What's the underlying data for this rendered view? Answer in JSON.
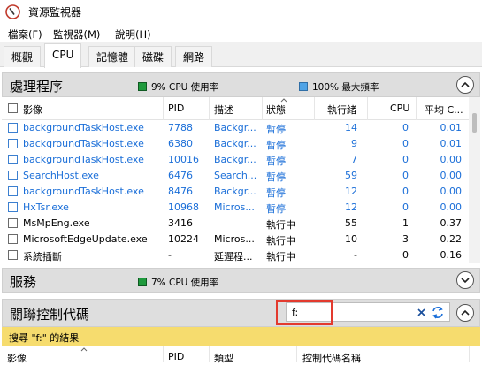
{
  "window": {
    "title": "資源監視器"
  },
  "menu": [
    "檔案(F)",
    "監視器(M)",
    "說明(H)"
  ],
  "tabs": [
    {
      "label": "概觀",
      "active": false
    },
    {
      "label": "CPU",
      "active": true
    },
    {
      "label": "記憶體",
      "active": false
    },
    {
      "label": "磁碟",
      "active": false
    },
    {
      "label": "網路",
      "active": false
    }
  ],
  "processes": {
    "title": "處理程序",
    "cpu_usage_text": "9% CPU 使用率",
    "max_freq_text": "100% 最大頻率",
    "columns": [
      "影像",
      "PID",
      "描述",
      "狀態",
      "執行緒",
      "CPU",
      "平均 C..."
    ],
    "rows": [
      {
        "image": "backgroundTaskHost.exe",
        "pid": "7788",
        "desc": "Backgr...",
        "status": "暫停",
        "threads": "14",
        "cpu": "0",
        "avg": "0.01",
        "suspended": true
      },
      {
        "image": "backgroundTaskHost.exe",
        "pid": "6380",
        "desc": "Backgr...",
        "status": "暫停",
        "threads": "9",
        "cpu": "0",
        "avg": "0.01",
        "suspended": true
      },
      {
        "image": "backgroundTaskHost.exe",
        "pid": "10016",
        "desc": "Backgr...",
        "status": "暫停",
        "threads": "7",
        "cpu": "0",
        "avg": "0.00",
        "suspended": true
      },
      {
        "image": "SearchHost.exe",
        "pid": "6476",
        "desc": "Search...",
        "status": "暫停",
        "threads": "59",
        "cpu": "0",
        "avg": "0.00",
        "suspended": true
      },
      {
        "image": "backgroundTaskHost.exe",
        "pid": "8476",
        "desc": "Backgr...",
        "status": "暫停",
        "threads": "12",
        "cpu": "0",
        "avg": "0.00",
        "suspended": true
      },
      {
        "image": "HxTsr.exe",
        "pid": "10968",
        "desc": "Micros...",
        "status": "暫停",
        "threads": "12",
        "cpu": "0",
        "avg": "0.00",
        "suspended": true
      },
      {
        "image": "MsMpEng.exe",
        "pid": "3416",
        "desc": "",
        "status": "執行中",
        "threads": "55",
        "cpu": "1",
        "avg": "0.37",
        "suspended": false
      },
      {
        "image": "MicrosoftEdgeUpdate.exe",
        "pid": "10224",
        "desc": "Micros...",
        "status": "執行中",
        "threads": "10",
        "cpu": "3",
        "avg": "0.22",
        "suspended": false
      },
      {
        "image": "系統插斷",
        "pid": "-",
        "desc": "延遲程...",
        "status": "執行中",
        "threads": "-",
        "cpu": "0",
        "avg": "0.16",
        "suspended": false
      }
    ]
  },
  "services": {
    "title": "服務",
    "cpu_usage_text": "7% CPU 使用率"
  },
  "handles": {
    "title": "關聯控制代碼",
    "search_value": "f:",
    "result_text": "搜尋 \"f:\" 的結果",
    "columns": [
      "影像",
      "PID",
      "類型",
      "控制代碼名稱"
    ]
  },
  "colors": {
    "suspended_text": "#1a6ed8",
    "result_bar": "#f6dc6e",
    "highlight": "#e33a2e"
  }
}
